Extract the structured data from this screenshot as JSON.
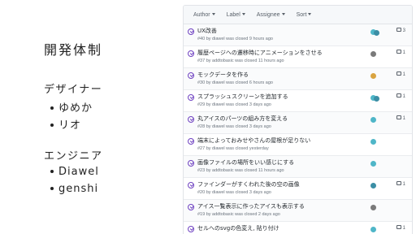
{
  "slide": {
    "team_title": "開発体制",
    "designer_heading": "デザイナー",
    "designers": [
      "ゆめか",
      "リオ"
    ],
    "engineer_heading": "エンジニア",
    "engineers": [
      "Diawel",
      "genshi"
    ]
  },
  "filters": {
    "author": "Author",
    "label": "Label",
    "assignee": "Assignee",
    "sort": "Sort"
  },
  "issues": [
    {
      "title": "UX改善",
      "meta": "#40 by diawel was closed 9 hours ago",
      "comments": "3",
      "avatars": [
        "a",
        "d"
      ]
    },
    {
      "title": "履歴ページへの遷移時にアニメーションをさせる",
      "meta": "#37 by addtobasic was closed 11 hours ago",
      "comments": "1",
      "avatars": [
        "b"
      ]
    },
    {
      "title": "モックデータを作る",
      "meta": "#30 by diawel was closed 6 hours ago",
      "comments": "1",
      "avatars": [
        "c"
      ]
    },
    {
      "title": "スプラッシュスクリーンを追加する",
      "meta": "#29 by diawel was closed 3 days ago",
      "comments": "1",
      "avatars": [
        "a",
        "d"
      ]
    },
    {
      "title": "丸アイスのパーツの組み方を変える",
      "meta": "#28 by diawel was closed 3 days ago",
      "comments": "1",
      "avatars": [
        "a"
      ]
    },
    {
      "title": "端末によっておみせやさんの屋根が足りない",
      "meta": "#27 by diawel was closed yesterday",
      "comments": "",
      "avatars": [
        "a"
      ]
    },
    {
      "title": "画像ファイルの場所をいい感じにする",
      "meta": "#23 by addtobasic was closed 11 hours ago",
      "comments": "",
      "avatars": [
        "a"
      ]
    },
    {
      "title": "ファインダーがすくわれた後の空の画像",
      "meta": "#20 by diawel was closed 3 days ago",
      "comments": "1",
      "avatars": [
        "d"
      ]
    },
    {
      "title": "アイス一覧表示に作ったアイスも表示する",
      "meta": "#19 by addtobasic was closed 2 days ago",
      "comments": "",
      "avatars": [
        "b"
      ]
    },
    {
      "title": "セルへのsvgの色変え, 貼り付け",
      "meta": "",
      "comments": "1",
      "avatars": [
        "a"
      ]
    }
  ]
}
